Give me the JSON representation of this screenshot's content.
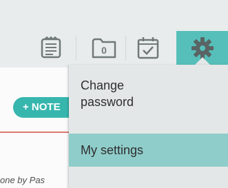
{
  "toolbar": {
    "notes_icon": "notes-icon",
    "folder_icon": "folder-icon",
    "folder_count": "0",
    "calendar_icon": "calendar-check-icon",
    "settings_icon": "gear-icon"
  },
  "main": {
    "add_note_label": "+ NOTE",
    "footer_text": "one by Pas"
  },
  "dropdown": {
    "items": [
      {
        "label_line1": "Change",
        "label_line2": "password"
      },
      {
        "label": "My settings"
      }
    ]
  },
  "colors": {
    "accent": "#56bfb9",
    "add_button": "#37b6ae",
    "menu_bg": "#e3e7e7",
    "menu_selected": "#8fcdca",
    "underline": "#d9796c"
  }
}
